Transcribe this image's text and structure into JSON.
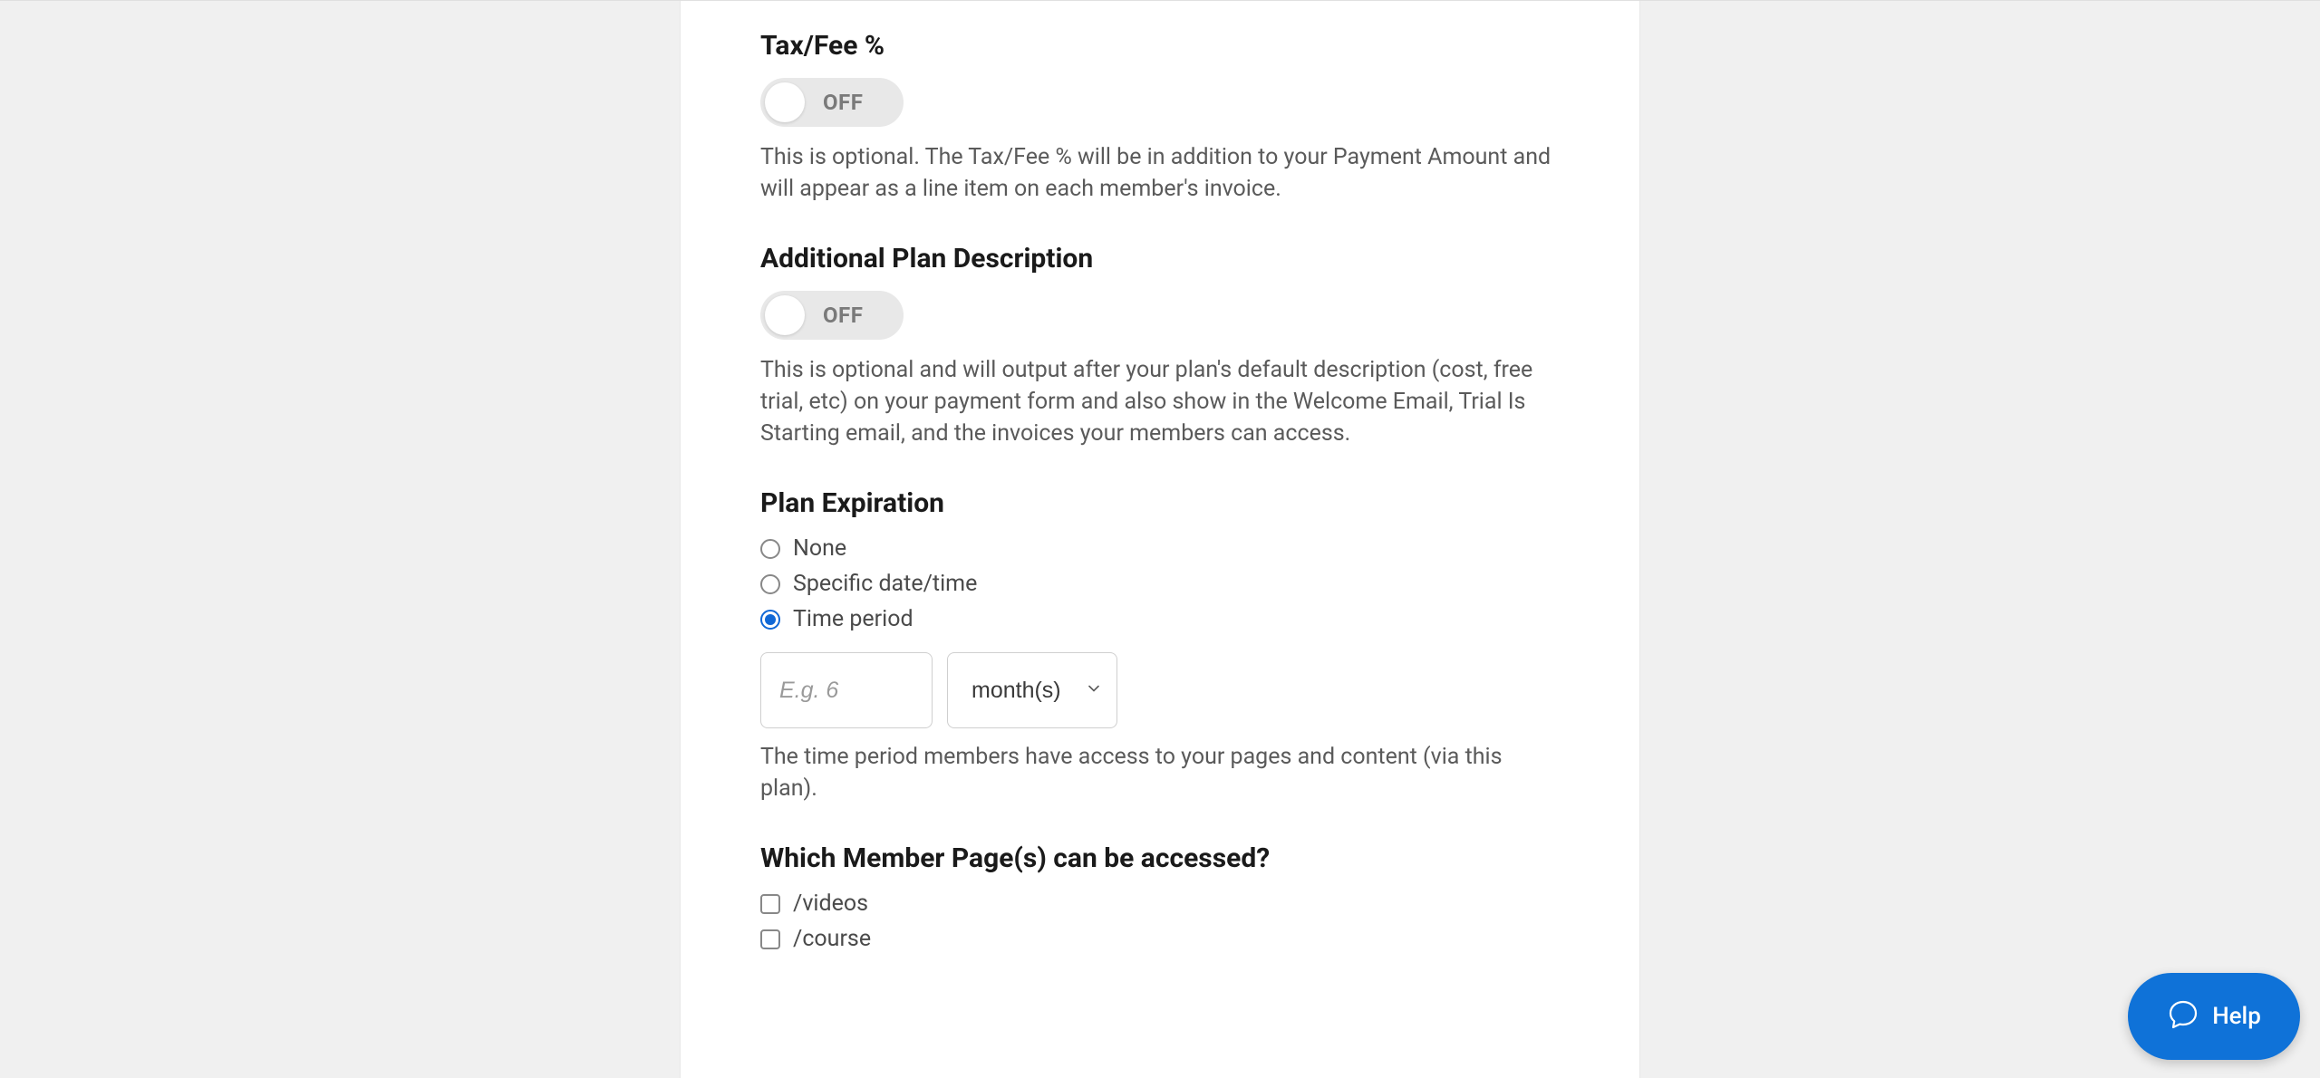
{
  "sections": {
    "tax_fee": {
      "title": "Tax/Fee %",
      "toggle_label": "OFF",
      "description": "This is optional. The Tax/Fee % will be in addition to your Payment Amount and will appear as a line item on each member's invoice."
    },
    "additional_desc": {
      "title": "Additional Plan Description",
      "toggle_label": "OFF",
      "description": "This is optional and will output after your plan's default description (cost, free trial, etc) on your payment form and also show in the Welcome Email, Trial Is Starting email, and the invoices your members can access."
    },
    "plan_expiration": {
      "title": "Plan Expiration",
      "options": {
        "none": "None",
        "specific": "Specific date/time",
        "time_period": "Time period"
      },
      "input_placeholder": "E.g. 6",
      "select_value": "month(s)",
      "description": "The time period members have access to your pages and content (via this plan)."
    },
    "member_pages": {
      "title": "Which Member Page(s) can be accessed?",
      "pages": {
        "videos": "/videos",
        "course": "/course"
      }
    }
  },
  "help": {
    "label": "Help"
  }
}
